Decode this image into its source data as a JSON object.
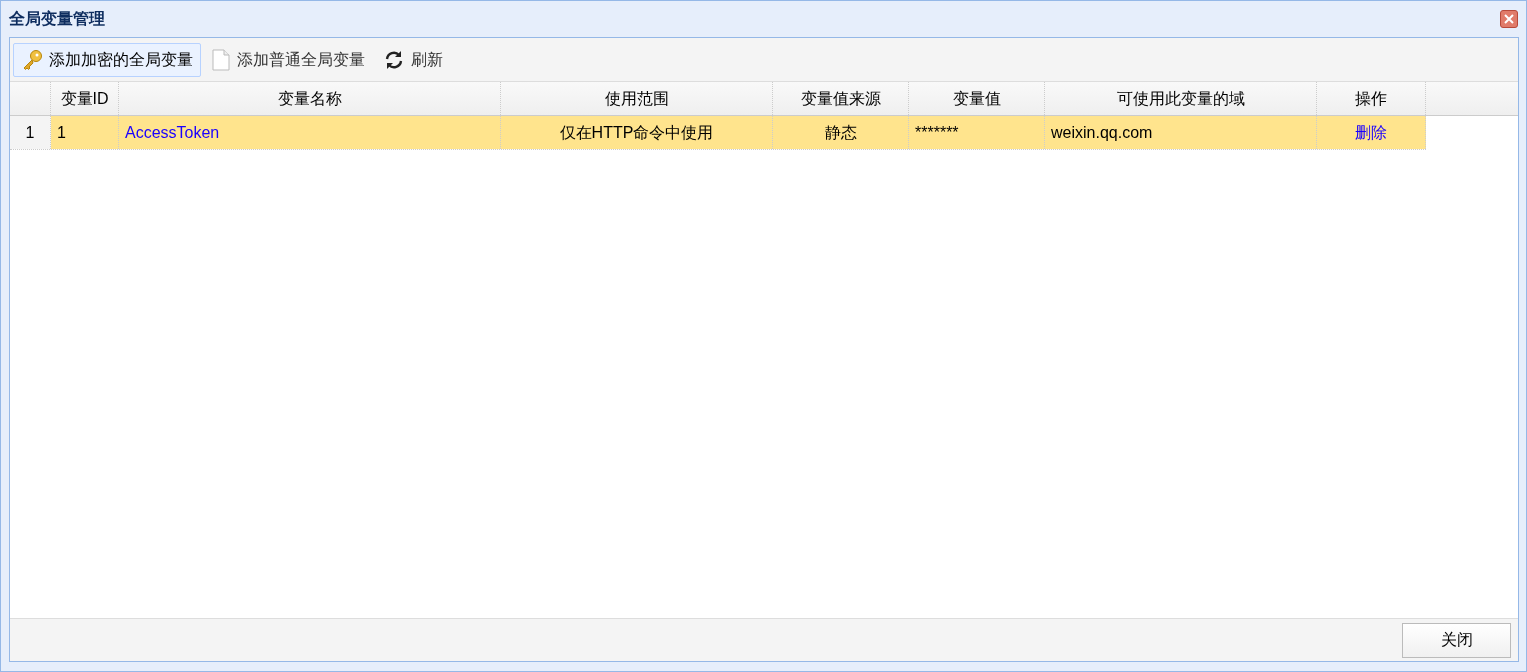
{
  "window": {
    "title": "全局变量管理"
  },
  "toolbar": [
    {
      "label": "添加加密的全局变量",
      "kind": "key",
      "active": true
    },
    {
      "label": "添加普通全局变量",
      "kind": "page",
      "active": false
    },
    {
      "label": "刷新",
      "kind": "refresh",
      "active": false
    }
  ],
  "table": {
    "columns": [
      "变量ID",
      "变量名称",
      "使用范围",
      "变量值来源",
      "变量值",
      "可使用此变量的域",
      "操作"
    ],
    "rows": [
      {
        "row_number": "1",
        "selected": true,
        "cells": [
          "1",
          "AccessToken",
          "仅在HTTP命令中使用",
          "静态",
          "*******",
          "weixin.qq.com",
          "删除"
        ]
      }
    ]
  },
  "footer": {
    "buttons": [
      "关闭"
    ]
  }
}
